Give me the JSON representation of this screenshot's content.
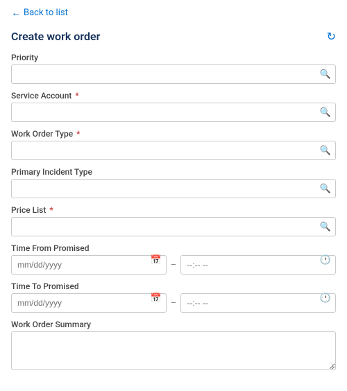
{
  "back": {
    "label": "Back to list",
    "arrow": "←"
  },
  "header": {
    "title": "Create work order",
    "refresh_icon": "↻"
  },
  "fields": {
    "priority": {
      "label": "Priority",
      "required": false,
      "placeholder": "",
      "type": "search"
    },
    "service_account": {
      "label": "Service Account",
      "required": true,
      "placeholder": "",
      "type": "search"
    },
    "work_order_type": {
      "label": "Work Order Type",
      "required": true,
      "placeholder": "",
      "type": "search"
    },
    "primary_incident_type": {
      "label": "Primary Incident Type",
      "required": false,
      "placeholder": "",
      "type": "search"
    },
    "price_list": {
      "label": "Price List",
      "required": true,
      "placeholder": "",
      "type": "search"
    },
    "time_from_promised": {
      "label": "Time From Promised",
      "date_placeholder": "mm/dd/yyyy",
      "time_placeholder": "--:-- --"
    },
    "time_to_promised": {
      "label": "Time To Promised",
      "date_placeholder": "mm/dd/yyyy",
      "time_placeholder": "--:-- --"
    },
    "work_order_summary": {
      "label": "Work Order Summary",
      "required": false,
      "placeholder": ""
    }
  },
  "icons": {
    "search": "🔍",
    "calendar": "📅",
    "clock": "🕐",
    "resize": "⤡",
    "refresh": "↻"
  }
}
